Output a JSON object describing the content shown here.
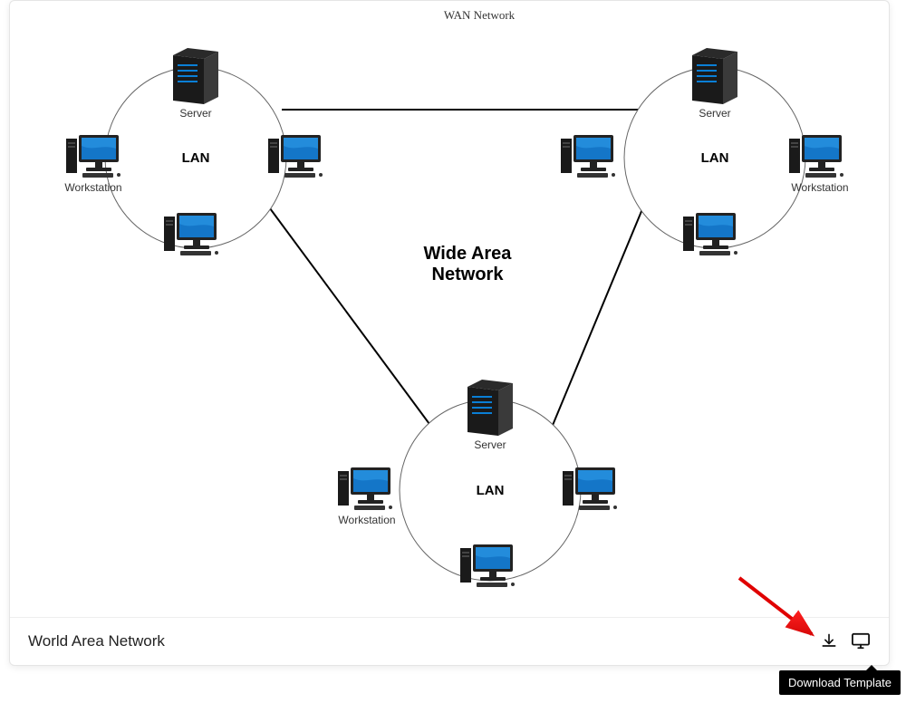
{
  "diagram": {
    "title": "WAN Network",
    "center_label_line1": "Wide Area",
    "center_label_line2": "Network",
    "lans": {
      "top_left": {
        "label": "LAN",
        "server": "Server",
        "workstation": "Workstation"
      },
      "top_right": {
        "label": "LAN",
        "server": "Server",
        "workstation": "Workstation"
      },
      "bottom": {
        "label": "LAN",
        "server": "Server",
        "workstation": "Workstation"
      }
    }
  },
  "footer": {
    "title": "World Area Network",
    "tooltip": "Download Template"
  }
}
